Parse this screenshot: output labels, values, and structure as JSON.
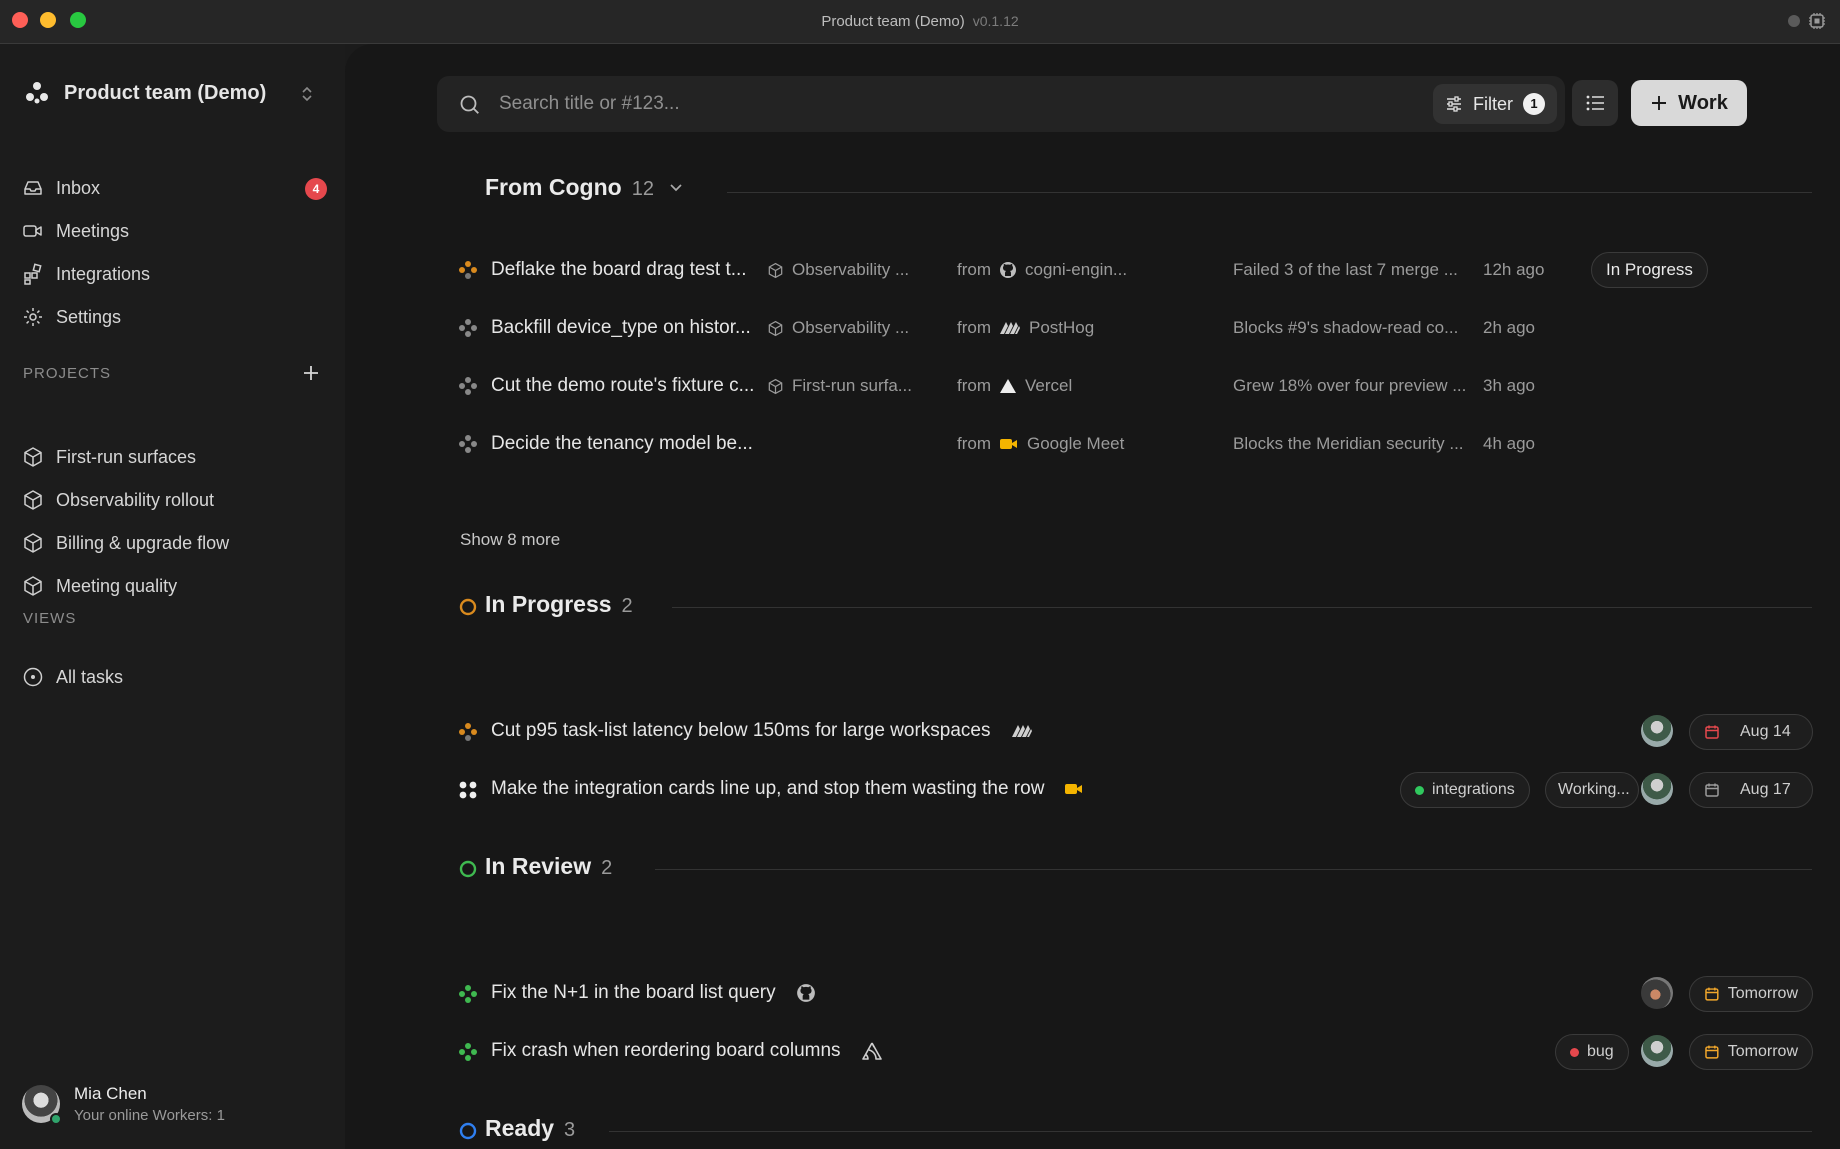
{
  "window": {
    "title": "Product team (Demo)",
    "version": "v0.1.12"
  },
  "sidebar": {
    "workspace": "Product team (Demo)",
    "nav": [
      {
        "label": "Inbox",
        "icon": "inbox-icon",
        "badge": "4"
      },
      {
        "label": "Meetings",
        "icon": "video-icon"
      },
      {
        "label": "Integrations",
        "icon": "integrations-icon"
      },
      {
        "label": "Settings",
        "icon": "gear-icon"
      }
    ],
    "projects_heading": "PROJECTS",
    "projects": [
      "First-run surfaces",
      "Observability rollout",
      "Billing & upgrade flow",
      "Meeting quality"
    ],
    "views_heading": "VIEWS",
    "views": [
      "All tasks"
    ],
    "user": {
      "name": "Mia Chen",
      "status": "Your online Workers: 1"
    }
  },
  "toolbar": {
    "search_placeholder": "Search title or #123...",
    "filter_label": "Filter",
    "filter_count": "1",
    "work_label": "Work"
  },
  "groups": {
    "cogno": {
      "title": "From Cogno",
      "count": "12",
      "rows": [
        {
          "title": "Deflake the board drag test t...",
          "project": "Observability ...",
          "from": "from",
          "source": "cogni-engin...",
          "source_icon": "github-icon",
          "note": "Failed 3 of the last 7 merge ...",
          "time": "12h ago",
          "status": "In Progress"
        },
        {
          "title": "Backfill device_type on histor...",
          "project": "Observability ...",
          "from": "from",
          "source": "PostHog",
          "source_icon": "posthog-icon",
          "note": "Blocks #9's shadow-read co...",
          "time": "2h ago"
        },
        {
          "title": "Cut the demo route's fixture c...",
          "project": "First-run surfa...",
          "from": "from",
          "source": "Vercel",
          "source_icon": "vercel-icon",
          "note": "Grew 18% over four preview ...",
          "time": "3h ago"
        },
        {
          "title": "Decide the tenancy model be...",
          "project": "",
          "from": "from",
          "source": "Google Meet",
          "source_icon": "google-meet-icon",
          "note": "Blocks the Meridian security ...",
          "time": "4h ago"
        }
      ],
      "show_more": "Show 8 more"
    },
    "in_progress": {
      "title": "In Progress",
      "count": "2",
      "color": "#d98a1e",
      "rows": [
        {
          "title": "Cut p95 task-list latency below 150ms for large workspaces",
          "source_icon": "posthog-icon",
          "date": "Aug 14"
        },
        {
          "title": "Make the integration cards line up, and stop them wasting the row",
          "source_icon": "google-meet-icon",
          "label": "integrations",
          "label_color": "#30c85e",
          "agent": "Working...",
          "date": "Aug 17"
        }
      ]
    },
    "in_review": {
      "title": "In Review",
      "count": "2",
      "color": "#3fb950",
      "rows": [
        {
          "title": "Fix the N+1 in the board list query",
          "source_icon": "github-icon",
          "date": "Tomorrow"
        },
        {
          "title": "Fix crash when reordering board columns",
          "source_icon": "sentry-icon",
          "label": "bug",
          "label_color": "#e5484d",
          "date": "Tomorrow"
        }
      ]
    },
    "ready": {
      "title": "Ready",
      "count": "3",
      "color": "#2f7ff0"
    }
  }
}
